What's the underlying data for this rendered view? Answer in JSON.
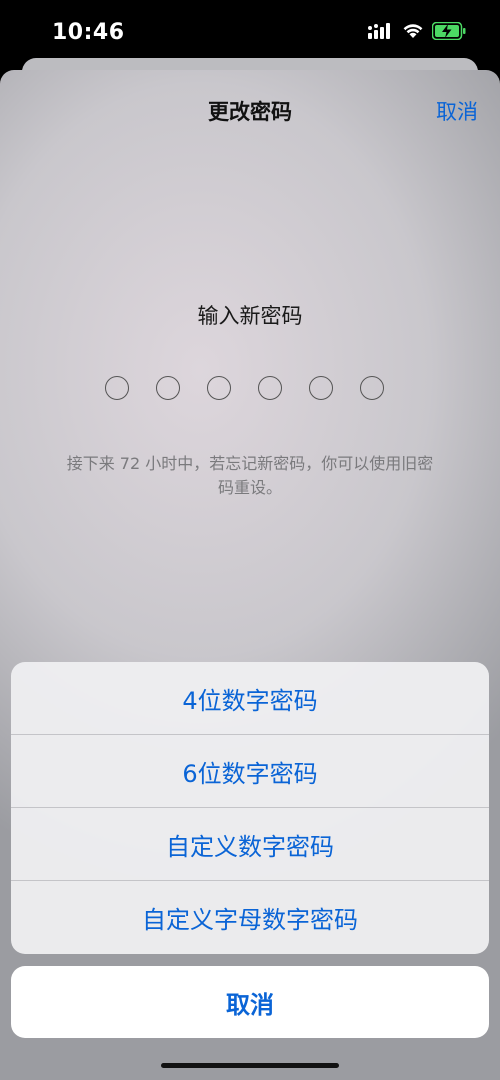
{
  "status_bar": {
    "time": "10:46",
    "icons": [
      "signal-icon",
      "wifi-icon",
      "battery-charging-icon"
    ],
    "battery_color": "#4cd964"
  },
  "nav": {
    "title": "更改密码",
    "cancel_label": "取消"
  },
  "passcode": {
    "prompt": "输入新密码",
    "digit_count": 6,
    "hint": "接下来 72 小时中，若忘记新密码，你可以使用旧密码重设。"
  },
  "action_sheet": {
    "options": [
      {
        "label": "4位数字密码"
      },
      {
        "label": "6位数字密码"
      },
      {
        "label": "自定义数字密码"
      },
      {
        "label": "自定义字母数字密码"
      }
    ],
    "cancel_label": "取消"
  },
  "colors": {
    "accent": "#0a64d6"
  }
}
